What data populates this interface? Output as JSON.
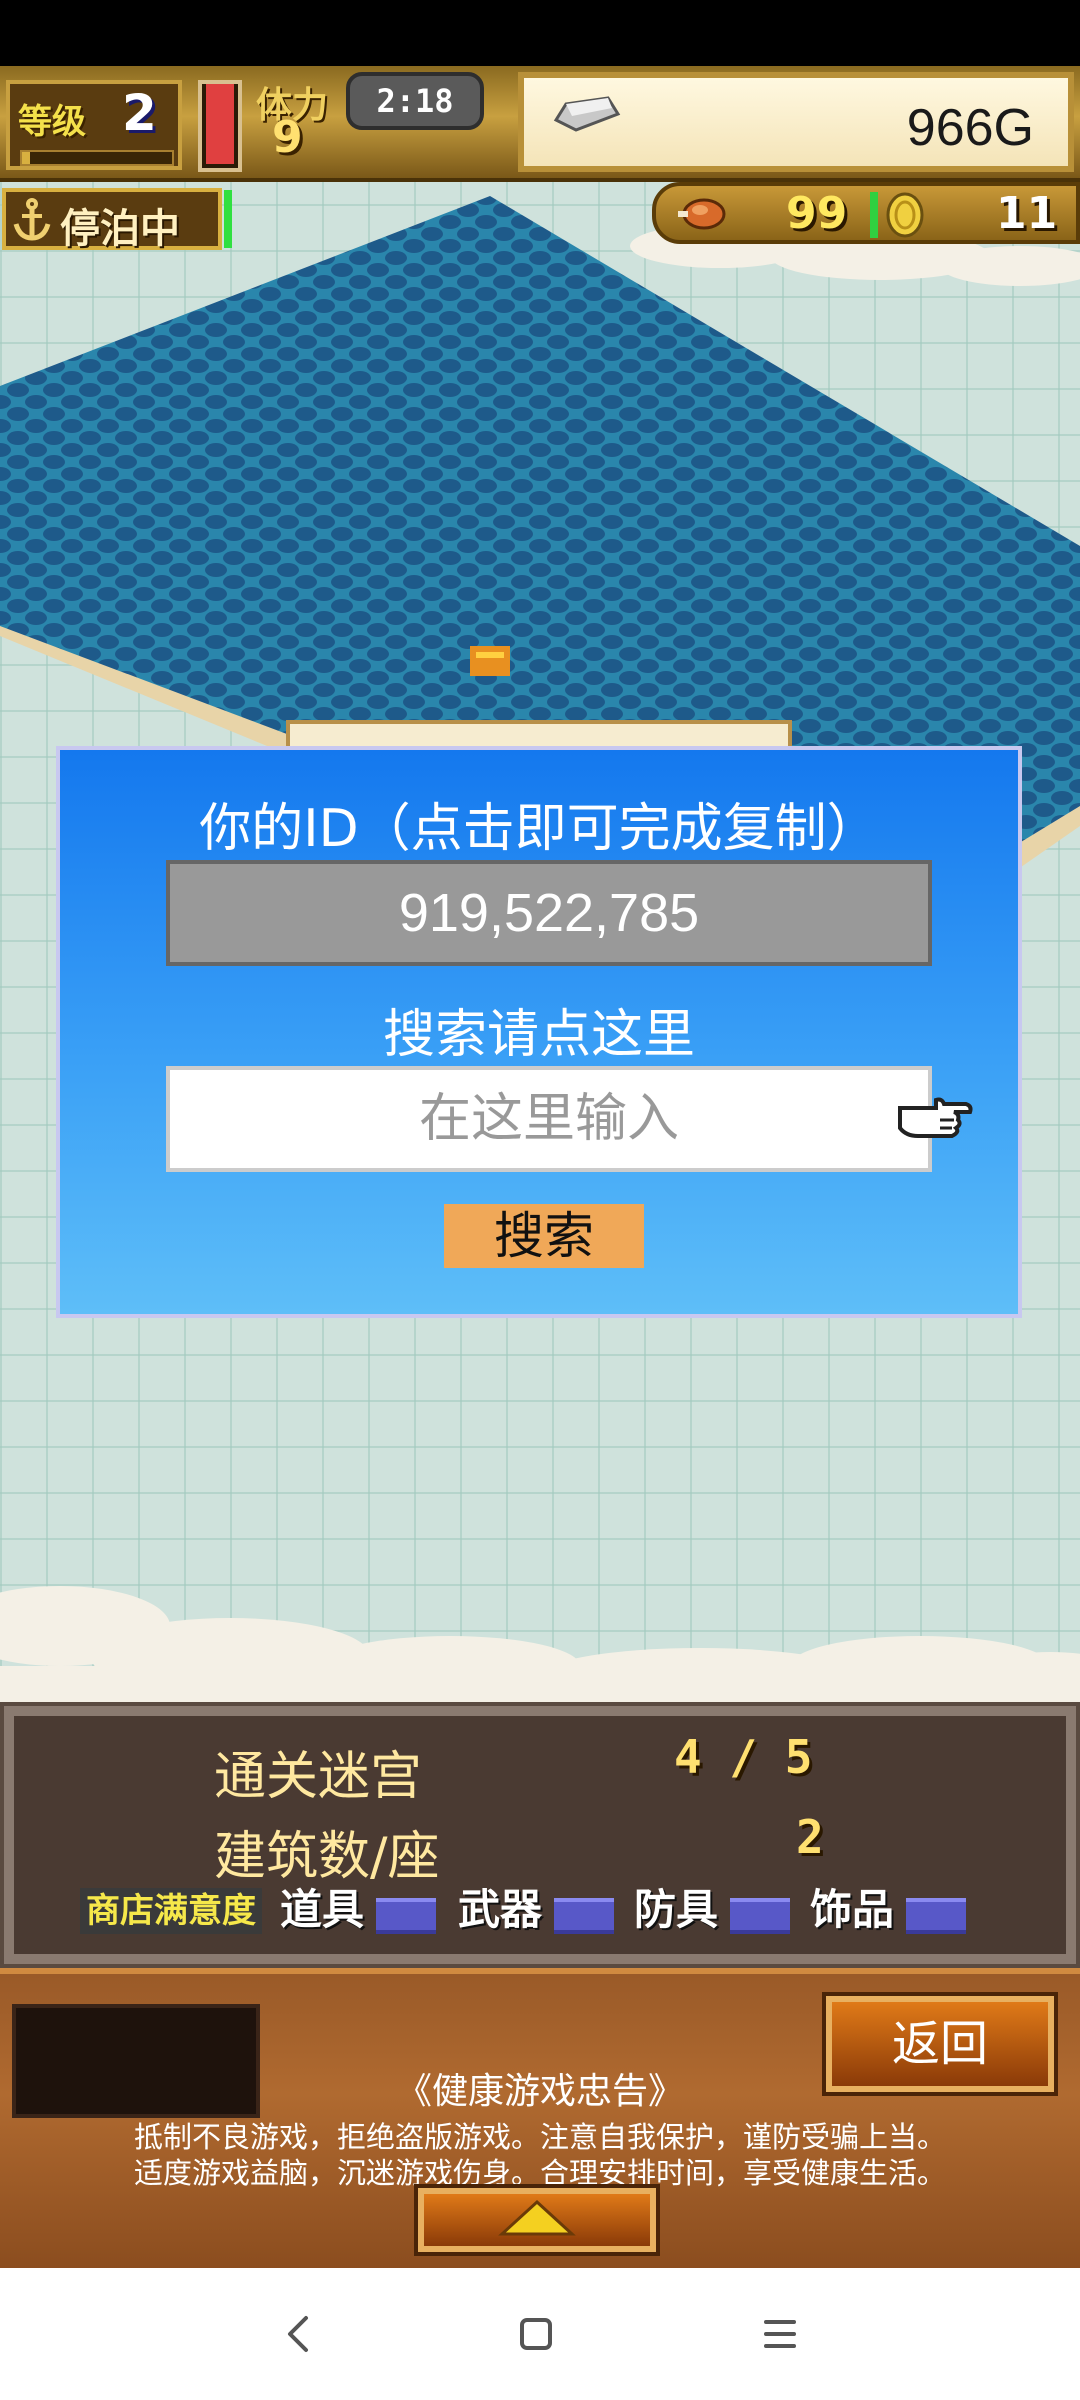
{
  "hud": {
    "level_label": "等级",
    "level_value": "2",
    "level_xp_fraction": 0.05,
    "stamina_fraction": 0.95,
    "stamina_label": "体力",
    "stamina_value": "9",
    "time": "2:18",
    "gold": "966G",
    "anchor_label": "停泊中",
    "meat_count": "99",
    "coin_count": "11"
  },
  "dialog": {
    "title": "你的ID（点击即可完成复制）",
    "id_value": "919,522,785",
    "search_title": "搜索请点这里",
    "search_placeholder": "在这里输入",
    "search_button": "搜索"
  },
  "stats": {
    "dungeons_label": "通关迷宫",
    "dungeons_value": "4 / 5",
    "buildings_label": "建筑数/座",
    "buildings_value": "2",
    "shop_satisfaction_label": "商店满意度",
    "categories": [
      "道具",
      "武器",
      "防具",
      "饰品"
    ]
  },
  "bottom": {
    "back_button": "返回",
    "notice_title": "《健康游戏忠告》",
    "notice_line1": "抵制不良游戏，拒绝盗版游戏。注意自我保护，谨防受骗上当。",
    "notice_line2": "适度游戏益脑，沉迷游戏伤身。合理安排时间，享受健康生活。"
  },
  "colors": {
    "dialog_top": "#1478ee",
    "dialog_bottom": "#5ebef8",
    "search_button": "#f0a858",
    "water": "#2a7ea8",
    "sand": "#e8d4a8"
  }
}
